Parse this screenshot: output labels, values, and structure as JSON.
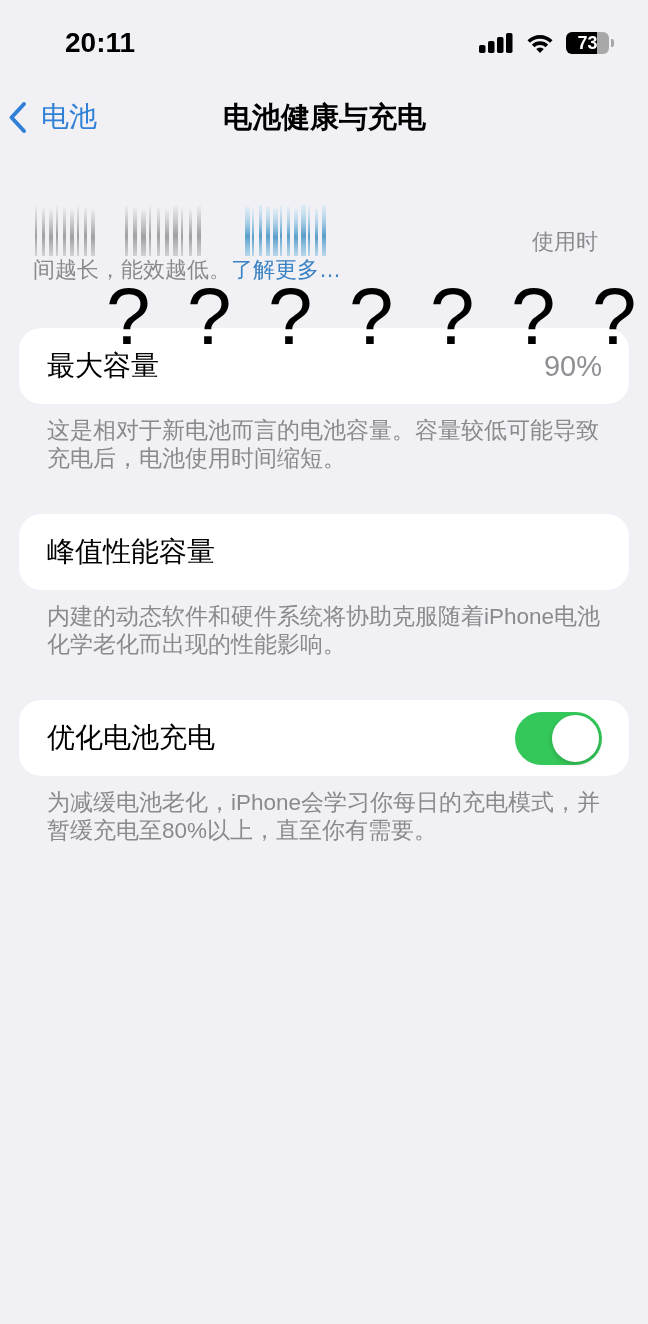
{
  "status_bar": {
    "time": "20:11",
    "battery": "73"
  },
  "nav": {
    "back_label": "电池",
    "title": "电池健康与充电"
  },
  "intro": {
    "line_end": "使用时",
    "text": "间越长，能效越低。",
    "link": "了解更多…"
  },
  "overlay_marks": [
    "?",
    "?",
    "?",
    "?",
    "?",
    "?",
    "?"
  ],
  "sections": [
    {
      "kind": "value",
      "label": "最大容量",
      "value": "90%",
      "footer": "这是相对于新电池而言的电池容量。容量较低可能导致充电后，电池使用时间缩短。"
    },
    {
      "kind": "plain",
      "label": "峰值性能容量",
      "footer": "内建的动态软件和硬件系统将协助克服随着iPhone电池化学老化而出现的性能影响。"
    },
    {
      "kind": "toggle",
      "label": "优化电池充电",
      "on": true,
      "footer": "为减缓电池老化，iPhone会学习你每日的充电模式，并暂缓充电至80%以上，直至你有需要。"
    }
  ]
}
